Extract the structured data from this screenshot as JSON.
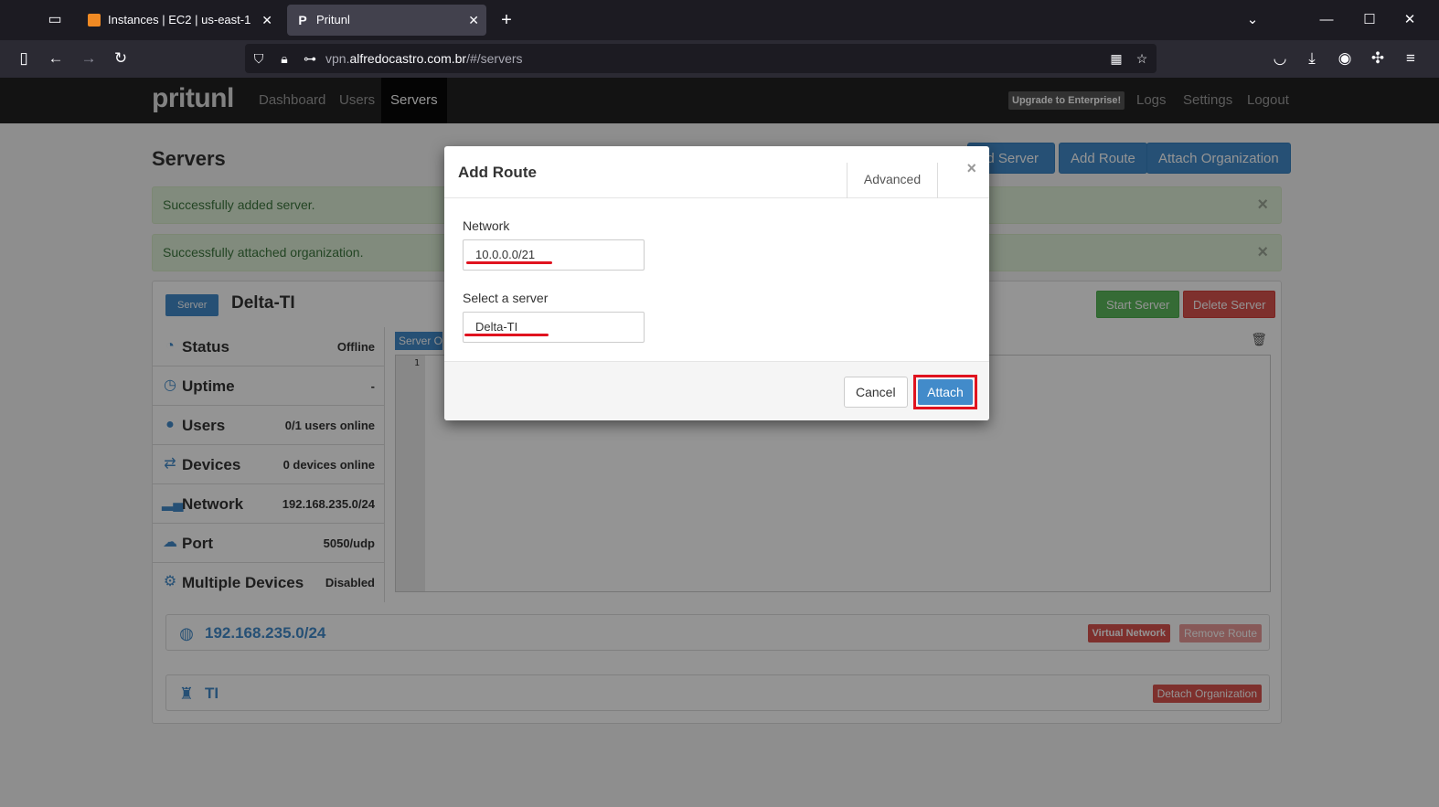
{
  "browser": {
    "tabs": [
      {
        "title": "Instances | EC2 | us-east-1"
      },
      {
        "title": "Pritunl"
      }
    ],
    "url_prefix": "vpn.",
    "url_host": "alfredocastro.com.br",
    "url_path": "/#/servers"
  },
  "app": {
    "brand": "pritunl",
    "nav": [
      "Dashboard",
      "Users",
      "Servers"
    ],
    "upgrade": "Upgrade to Enterprise!",
    "nav_right": [
      "Logs",
      "Settings",
      "Logout"
    ]
  },
  "page": {
    "title": "Servers",
    "buttons": {
      "add_server": "dd Server",
      "add_route": "Add Route",
      "attach_org": "Attach Organization"
    },
    "alerts": [
      "Successfully added server.",
      "Successfully attached organization."
    ]
  },
  "server": {
    "label": "Server",
    "name": "Delta-TI",
    "start": "Start Server",
    "delete": "Delete Server",
    "stats": [
      {
        "name": "Status",
        "value": "Offline",
        "icon": "dashboard-icon"
      },
      {
        "name": "Uptime",
        "value": "-",
        "icon": "clock-icon"
      },
      {
        "name": "Users",
        "value": "0/1 users online",
        "icon": "user-icon"
      },
      {
        "name": "Devices",
        "value": "0 devices online",
        "icon": "transfer-icon"
      },
      {
        "name": "Network",
        "value": "192.168.235.0/24",
        "icon": "signal-icon"
      },
      {
        "name": "Port",
        "value": "5050/udp",
        "icon": "upload-cloud-icon"
      },
      {
        "name": "Multiple Devices",
        "value": "Disabled",
        "icon": "cog-icon"
      }
    ],
    "output_tab": "Server Output",
    "line_number": "1",
    "route": {
      "network": "192.168.235.0/24",
      "virtual": "Virtual Network",
      "remove": "Remove Route"
    },
    "org": {
      "name": "TI",
      "detach": "Detach Organization"
    }
  },
  "modal": {
    "title": "Add Route",
    "advanced": "Advanced",
    "close": "×",
    "network_label": "Network",
    "network_value": "10.0.0.0/21",
    "server_label": "Select a server",
    "server_value": "Delta-TI",
    "cancel": "Cancel",
    "attach": "Attach"
  },
  "colors": {
    "primary": "#428bca",
    "danger": "#d9534f",
    "success": "#5cb85c",
    "highlight": "#e0131f"
  }
}
